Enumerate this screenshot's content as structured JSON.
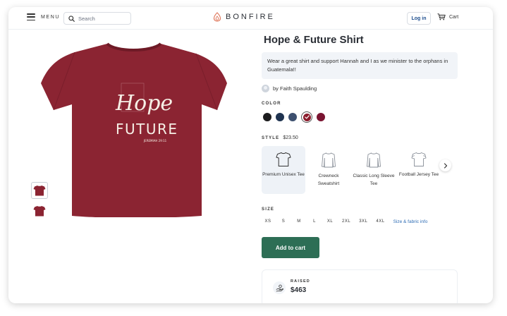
{
  "header": {
    "menu_label": "MENU",
    "search_placeholder": "Search",
    "brand": "BONFIRE",
    "login_label": "Log in",
    "cart_label": "Cart"
  },
  "product": {
    "title": "Hope & Future Shirt",
    "description": "Wear a great shirt and support Hannah and I as we minister to the orphans in Guatemala!!",
    "author": "by Faith Spaulding",
    "shirt_print_line1": "Hope",
    "shirt_print_line2": "FUTURE",
    "shirt_print_small": "JEREMIAH 29:11"
  },
  "color": {
    "label": "COLOR",
    "swatches": [
      "#1c1c1e",
      "#1f3350",
      "#3d506f",
      "#8b1c2c",
      "#7a1431"
    ],
    "selected_index": 3
  },
  "style": {
    "label": "STYLE",
    "price": "$23.50",
    "options": [
      "Premium Unisex Tee",
      "Crewneck Sweatshirt",
      "Classic Long Sleeve Tee",
      "Football Jersey Tee"
    ],
    "selected_index": 0
  },
  "size": {
    "label": "SIZE",
    "options": [
      "XS",
      "S",
      "M",
      "L",
      "XL",
      "2XL",
      "3XL",
      "4XL"
    ],
    "info_link": "Size & fabric info"
  },
  "cta": {
    "add_to_cart": "Add to cart"
  },
  "raised": {
    "label": "RAISED",
    "amount": "$463"
  },
  "colors": {
    "shirt": "#8b2432",
    "button": "#2d6e55",
    "link": "#2f6db5"
  }
}
